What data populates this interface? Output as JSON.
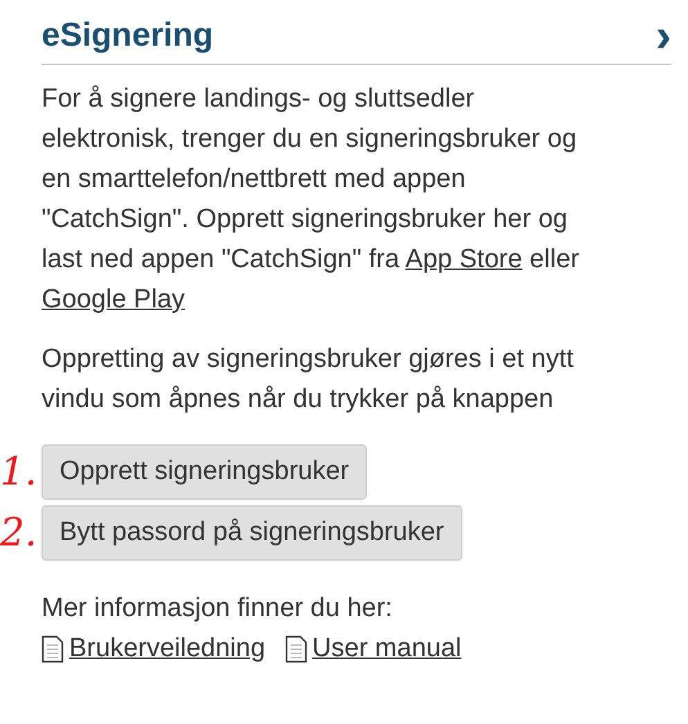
{
  "panel": {
    "title": "eSignering",
    "chevron": "›"
  },
  "intro": [
    {
      "kind": "text",
      "text": "For å signere landings- og sluttsedler elektronisk, trenger du en signeringsbruker og en smarttelefon/nettbrett med appen \"CatchSign\". Opprett signeringsbruker her og last ned appen \"CatchSign\" fra "
    },
    {
      "kind": "link",
      "text": "App Store"
    },
    {
      "kind": "text",
      "text": " eller "
    },
    {
      "kind": "link",
      "text": "Google Play"
    }
  ],
  "note": "Oppretting av signeringsbruker gjøres i et nytt vindu som åpnes når du trykker på knappen",
  "buttons": [
    {
      "annotation": "1.",
      "label": "Opprett signeringsbruker"
    },
    {
      "annotation": "2.",
      "label": "Bytt passord på signeringsbruker"
    }
  ],
  "more_info": "Mer informasjon finner du her:",
  "documents": [
    "Brukerveiledning",
    "User manual"
  ]
}
